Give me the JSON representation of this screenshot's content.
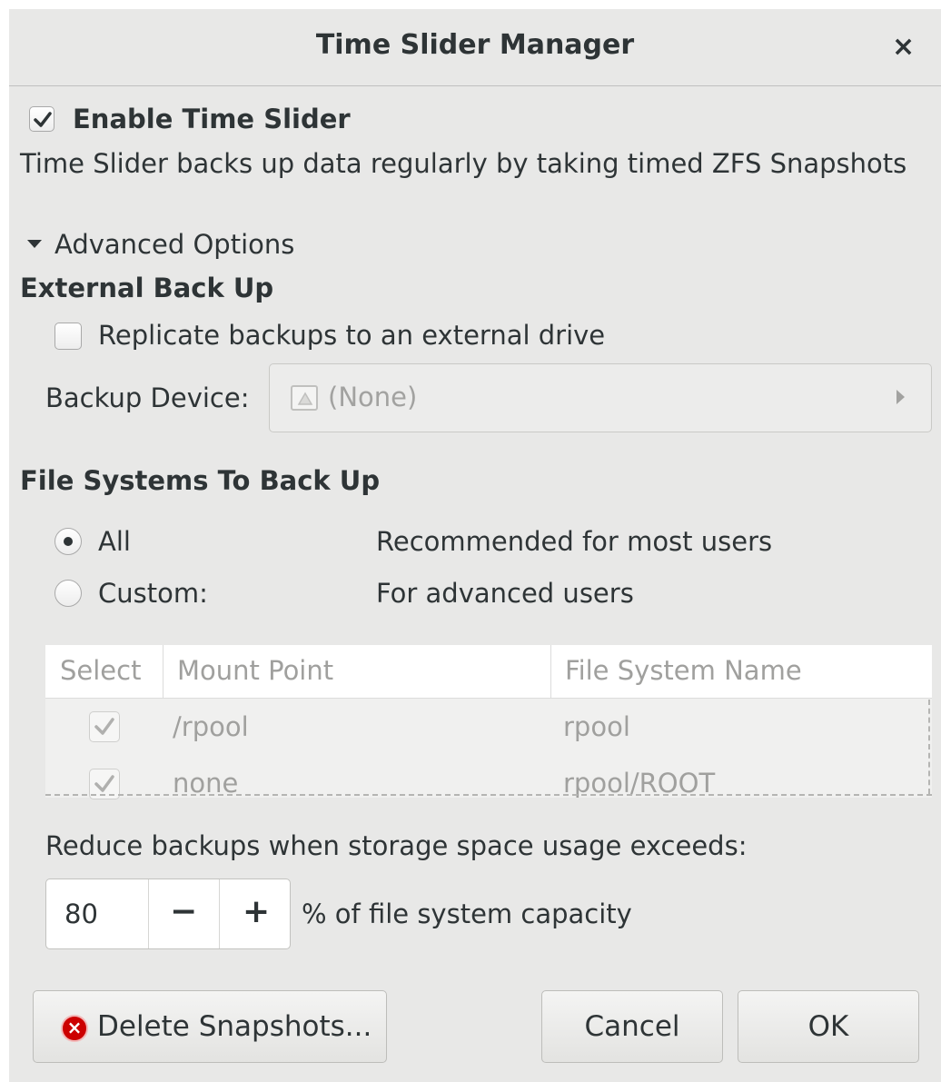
{
  "window": {
    "title": "Time Slider Manager",
    "close_glyph": "×"
  },
  "enable": {
    "label": "Enable Time Slider",
    "checked": true,
    "description": "Time Slider backs up data regularly by taking timed ZFS Snapshots"
  },
  "advanced": {
    "label": "Advanced Options",
    "expanded": true
  },
  "external": {
    "heading": "External Back Up",
    "replicate_label": "Replicate backups to an external drive",
    "replicate_checked": false,
    "device_label": "Backup Device:",
    "device_value": "(None)"
  },
  "filesystems": {
    "heading": "File Systems To Back Up",
    "options": [
      {
        "label": "All",
        "description": "Recommended for most users",
        "selected": true
      },
      {
        "label": "Custom:",
        "description": "For advanced users",
        "selected": false
      }
    ],
    "columns": [
      "Select",
      "Mount Point",
      "File System Name"
    ],
    "rows": [
      {
        "checked": true,
        "mount": "/rpool",
        "name": "rpool"
      },
      {
        "checked": true,
        "mount": "none",
        "name": "rpool/ROOT"
      }
    ]
  },
  "reduce": {
    "label": "Reduce backups when storage space usage exceeds:",
    "value": "80",
    "minus": "−",
    "plus": "+",
    "suffix": "% of file system capacity"
  },
  "buttons": {
    "delete": "Delete Snapshots...",
    "cancel": "Cancel",
    "ok": "OK"
  },
  "icons": {
    "delete": "error-circle-icon",
    "device": "drive-icon",
    "close": "close-icon"
  },
  "colors": {
    "background": "#e8e8e7",
    "disabled_text": "#a0a09e",
    "delete_icon": "#cc0000"
  }
}
